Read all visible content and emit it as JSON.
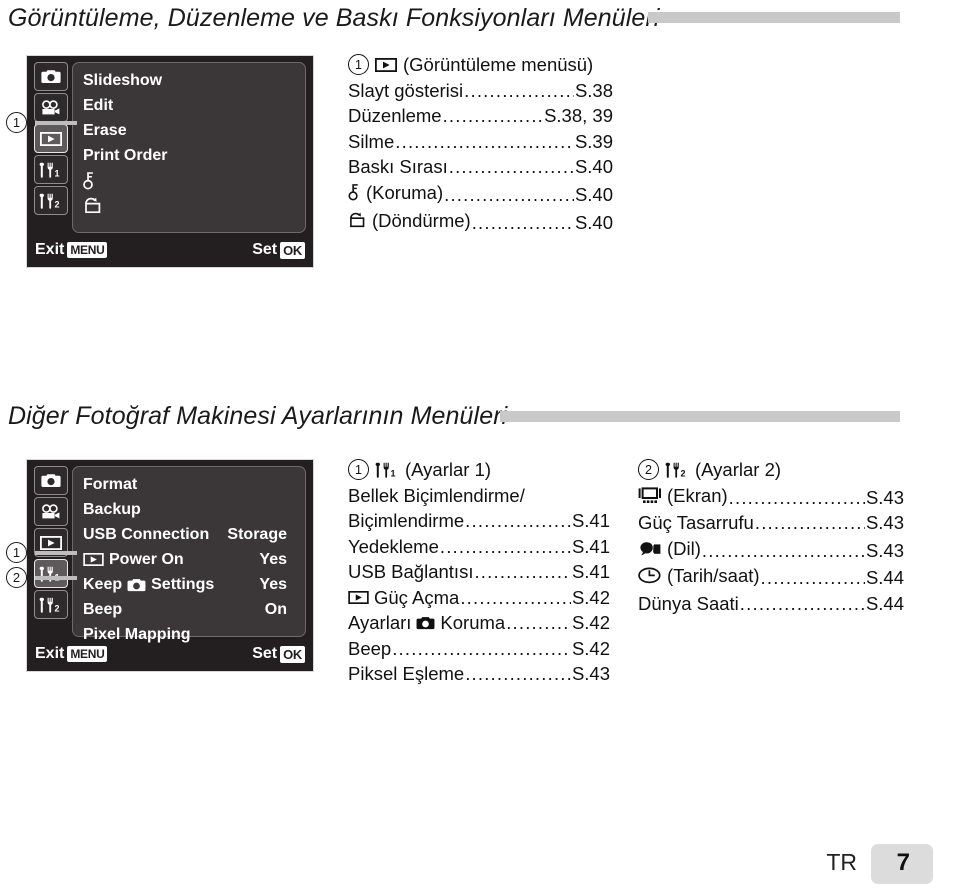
{
  "sections": [
    {
      "heading": "Görüntüleme, Düzenleme ve Baskı Fonksiyonları Menüleri",
      "lcd": {
        "tabs": [
          "camera-icon",
          "movie-icon",
          "playback-icon",
          "wrench1-icon",
          "wrench2-icon"
        ],
        "selected_tab_index": 2,
        "rows": [
          {
            "label": "Slideshow",
            "value": ""
          },
          {
            "label": "Edit",
            "value": ""
          },
          {
            "label": "Erase",
            "value": ""
          },
          {
            "label": "Print Order",
            "value": ""
          },
          {
            "label": "",
            "icon": "key-icon",
            "value": ""
          },
          {
            "label": "",
            "icon": "rotate-icon",
            "value": ""
          }
        ],
        "exit_label": "Exit",
        "exit_key": "MENU",
        "set_label": "Set",
        "set_key": "OK"
      },
      "callouts": [
        {
          "number": "1",
          "target_tab_index": 2
        }
      ],
      "reference": {
        "number": "1",
        "icon": "playback-icon",
        "title": "(Görüntüleme menüsü)",
        "lines": [
          {
            "label": "Slayt gösterisi",
            "page": "S.38"
          },
          {
            "label": "Düzenleme",
            "page": "S.38, 39"
          },
          {
            "label": "Silme",
            "page": "S.39"
          },
          {
            "label": "Baskı Sırası",
            "page": "S.40"
          },
          {
            "icon": "key-icon",
            "label": "(Koruma)",
            "page": "S.40"
          },
          {
            "icon": "rotate-icon",
            "label": "(Döndürme)",
            "page": "S.40"
          }
        ]
      }
    },
    {
      "heading": "Diğer Fotoğraf Makinesi Ayarlarının Menüleri",
      "lcd": {
        "tabs": [
          "camera-icon",
          "movie-icon",
          "playback-icon",
          "wrench1-icon",
          "wrench2-icon"
        ],
        "selected_tab_index": 3,
        "rows": [
          {
            "label": "Format",
            "value": ""
          },
          {
            "label": "Backup",
            "value": ""
          },
          {
            "label": "USB Connection",
            "value": "Storage"
          },
          {
            "label": "Power On",
            "icon": "playback-icon",
            "value": "Yes"
          },
          {
            "label_pre": "Keep",
            "label_post": "Settings",
            "icon": "camera-icon",
            "value": "Yes"
          },
          {
            "label": "Beep",
            "value": "On"
          },
          {
            "label": "Pixel Mapping",
            "value": ""
          }
        ],
        "exit_label": "Exit",
        "exit_key": "MENU",
        "set_label": "Set",
        "set_key": "OK"
      },
      "callouts": [
        {
          "number": "1",
          "target_tab_index": 3
        },
        {
          "number": "2",
          "target_tab_index": 4
        }
      ],
      "references": [
        {
          "number": "1",
          "icon": "wrench1-icon",
          "title": "(Ayarlar 1)",
          "lines": [
            {
              "label": "Bellek Biçimlendirme/",
              "page": "",
              "nodots": true
            },
            {
              "label": "Biçimlendirme",
              "page": "S.41"
            },
            {
              "label": "Yedekleme",
              "page": "S.41"
            },
            {
              "label": "USB Bağlantısı",
              "page": "S.41"
            },
            {
              "icon": "playback-icon",
              "label": "Güç Açma",
              "page": "S.42"
            },
            {
              "label_pre": "Ayarları",
              "label_post": "Koruma",
              "icon": "camera-icon",
              "page": "S.42"
            },
            {
              "label": "Beep",
              "page": "S.42"
            },
            {
              "label": "Piksel Eşleme",
              "page": "S.43"
            }
          ]
        },
        {
          "number": "2",
          "icon": "wrench2-icon",
          "title": "(Ayarlar 2)",
          "lines": [
            {
              "icon": "monitor-icon",
              "label": "(Ekran)",
              "page": "S.43"
            },
            {
              "label": "Güç Tasarrufu",
              "page": "S.43"
            },
            {
              "icon": "language-icon",
              "label": "(Dil)",
              "page": "S.43"
            },
            {
              "icon": "clock-icon",
              "label": "(Tarih/saat)",
              "page": "S.44"
            },
            {
              "label": "Dünya Saati",
              "page": "S.44"
            }
          ]
        }
      ]
    }
  ],
  "footer": {
    "locale": "TR",
    "page_number": "7"
  },
  "colors": {
    "rule": "#c9c9c9",
    "lcd_bg": "#231f20",
    "lcd_pane": "#3b3738",
    "tab_selected": "#5e5a5b",
    "footer_box": "#dcdcdc"
  },
  "dots": "................................................."
}
